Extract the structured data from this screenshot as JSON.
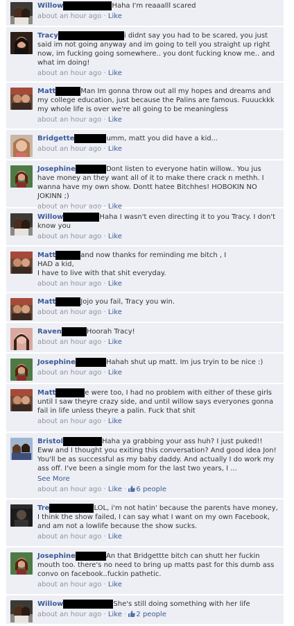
{
  "labels": {
    "like": "Like",
    "sep": "·"
  },
  "colors": {
    "name": "#3b5998",
    "meta": "#8c93a3",
    "bg": "#edeff4",
    "redaction": "#000000"
  },
  "comments": [
    {
      "author": "Willow",
      "text": "Haha I'm reaaalll scared",
      "time": "about an hour ago",
      "avatar": "willow"
    },
    {
      "author": "Tracy",
      "text": "i didnt say you had to be scared, you just said im not going anyway and im going to tell you straight up right now, im fucking going somewhere.. you dont fucking know me.. and what im doing!",
      "time": "about an hour ago",
      "avatar": "tracy"
    },
    {
      "author": "Matt",
      "text": "Man Im gonna throw out all my hopes and dreams and my college education, just because the Palins are famous. Fuuuckkk my whole life is over we're all going to be meaningless",
      "time": "about an hour ago",
      "avatar": "matt"
    },
    {
      "author": "Bridgette",
      "text": "umm, matt you did have a kid...",
      "time": "about an hour ago",
      "avatar": "bridgette"
    },
    {
      "author": "Josephine",
      "text": "Dont listen to everyone hatin willow.. You jus have money an they want all of it to make there crack n methh. I wanna have my own show. Dontt hatee Bitchhes! HOBOKIN NO JOKINN ;)",
      "time": "about an hour ago",
      "avatar": "josephine"
    },
    {
      "author": "Willow",
      "text": "Haha I wasn't even directing it to you Tracy. I don't know you",
      "time": "about an hour ago",
      "avatar": "willow"
    },
    {
      "author": "Matt",
      "text": "and now thanks for reminding me bitch , I\nHAD a kid,\nI have to live with that shit everyday.",
      "time": "about an hour ago",
      "avatar": "matt"
    },
    {
      "author": "Matt",
      "text": "Jojo you fail, Tracy you win.",
      "time": "about an hour ago",
      "avatar": "matt"
    },
    {
      "author": "Raven",
      "text": "Hoorah Tracy!",
      "time": "about an hour ago",
      "avatar": "raven"
    },
    {
      "author": "Josephine",
      "text": "Hahah shut up matt. Im jus tryin to be nice :)",
      "time": "about an hour ago",
      "avatar": "josephine"
    },
    {
      "author": "Matt",
      "text": "e were too, I had no problem with either of these girls until I saw theyre crazy side, and until willow says everyones gonna fail in life unless theyre a palin. Fuck that shit",
      "time": "about an hour ago",
      "avatar": "matt"
    },
    {
      "author": "Bristol",
      "text": "Haha ya grabbing your ass huh? I just puked!! Eww and I thought you exiting this conversation? And good idea Jon! You'll be as successful as my baby daddy. And actually I do work my ass off. I've been a single mom for the last two years, I ...",
      "see_more": "See More",
      "time": "about an hour ago",
      "likes": "6 people",
      "avatar": "bristol"
    },
    {
      "author": "Tre",
      "text": "LOL, i'm not hatin' because the parents have money, I think the show failed, I can say what I want on my own Facebook, and am not a lowlife because the show sucks.",
      "time": "about an hour ago",
      "avatar": "tre"
    },
    {
      "author": "Josephine",
      "text": "An that Bridgettte bitch can shutt her fuckin mouth too. there's no need to bring up matts past for this dumb ass convo on facebook..fuckin pathetic.",
      "time": "about an hour ago",
      "avatar": "josephine"
    },
    {
      "author": "Willow",
      "text": "She's still doing something with her life",
      "time": "about an hour ago",
      "likes": "2 people",
      "avatar": "willow"
    }
  ]
}
